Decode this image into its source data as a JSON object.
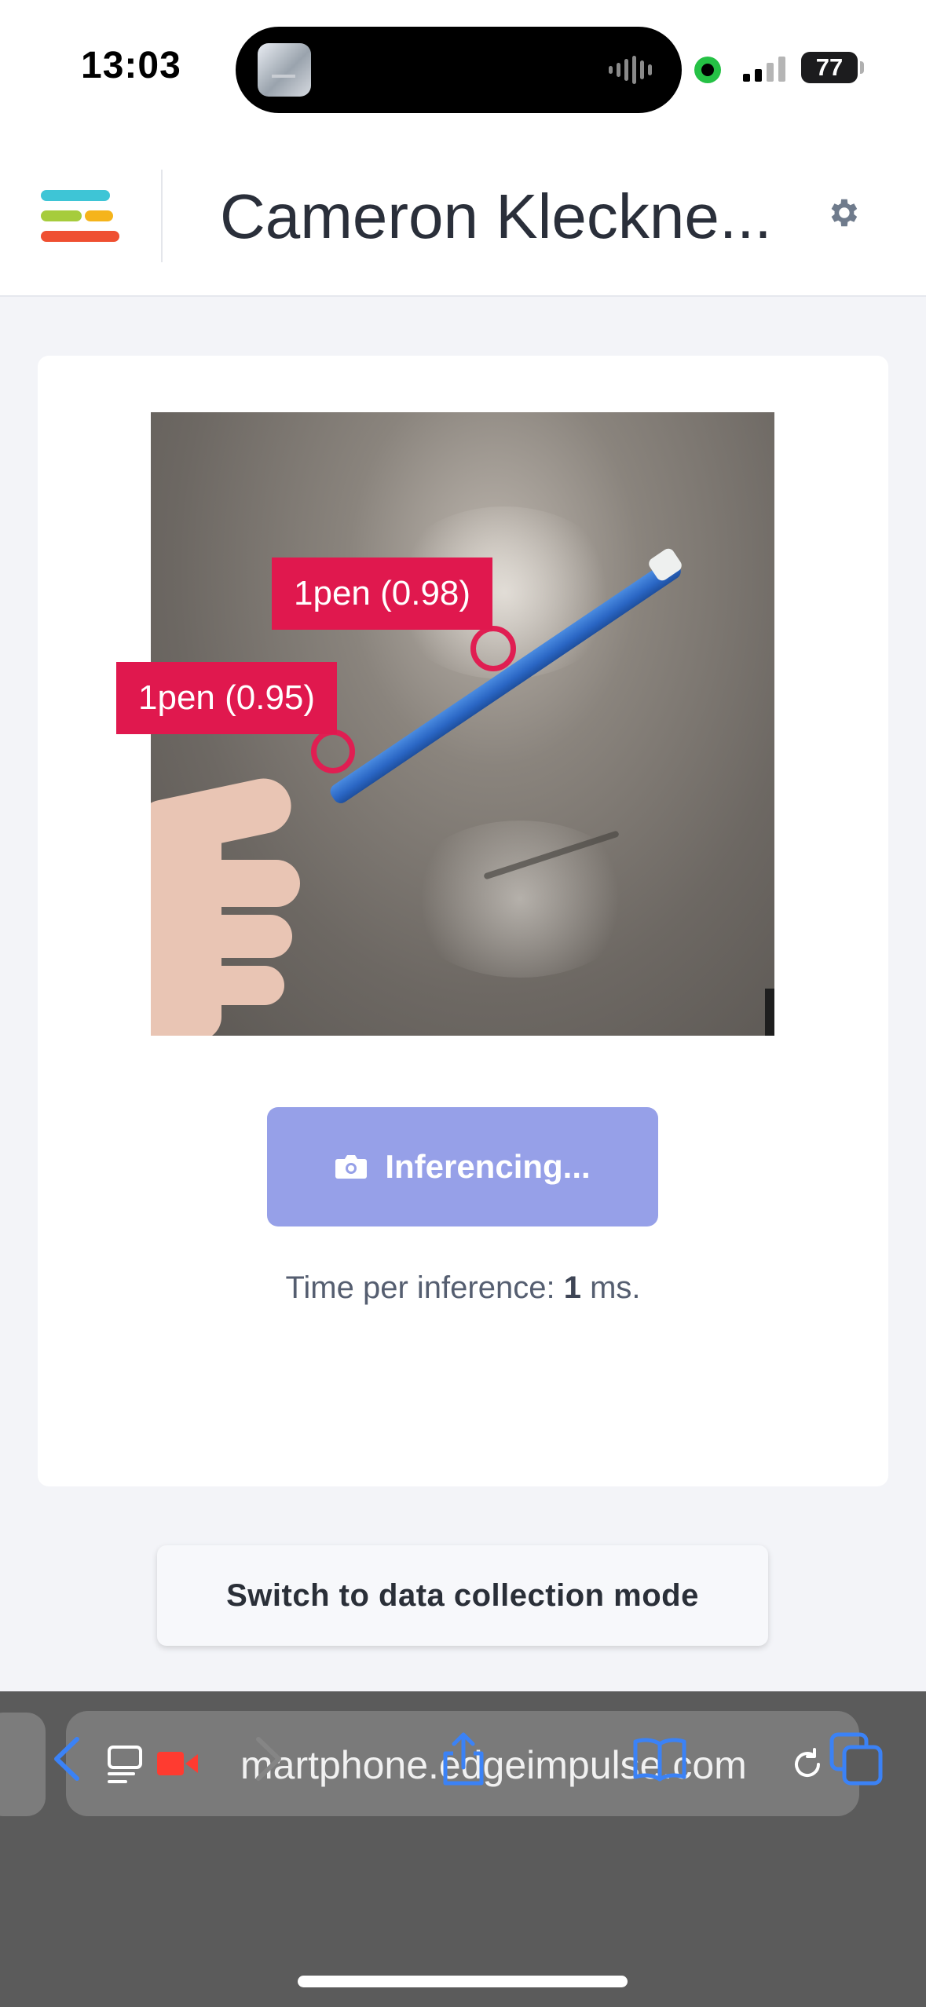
{
  "status_bar": {
    "time": "13:03",
    "battery": "77"
  },
  "header": {
    "project_title": "Cameron Kleckne...",
    "settings_icon": "gear-icon",
    "menu_icon": "edge-impulse-logo"
  },
  "classifier": {
    "detections": [
      {
        "label": "1pen (0.98)"
      },
      {
        "label": "1pen (0.95)"
      }
    ],
    "inference_button": {
      "label": "Inferencing...",
      "icon": "camera-icon"
    },
    "time_per_inference": {
      "prefix": "Time per inference:",
      "value": "1",
      "suffix": "ms."
    }
  },
  "switch_mode_button": {
    "label": "Switch to data collection mode"
  },
  "browser": {
    "url": "martphone.edgeimpulse.com",
    "toolbar": [
      "back-icon",
      "forward-icon",
      "share-icon",
      "bookmarks-icon",
      "tabs-icon"
    ],
    "colors": {
      "accent": "#3b82f6",
      "recording": "#ff3b30"
    }
  },
  "colors": {
    "detection": "#e0184e",
    "inference_button": "#96a0e8"
  }
}
